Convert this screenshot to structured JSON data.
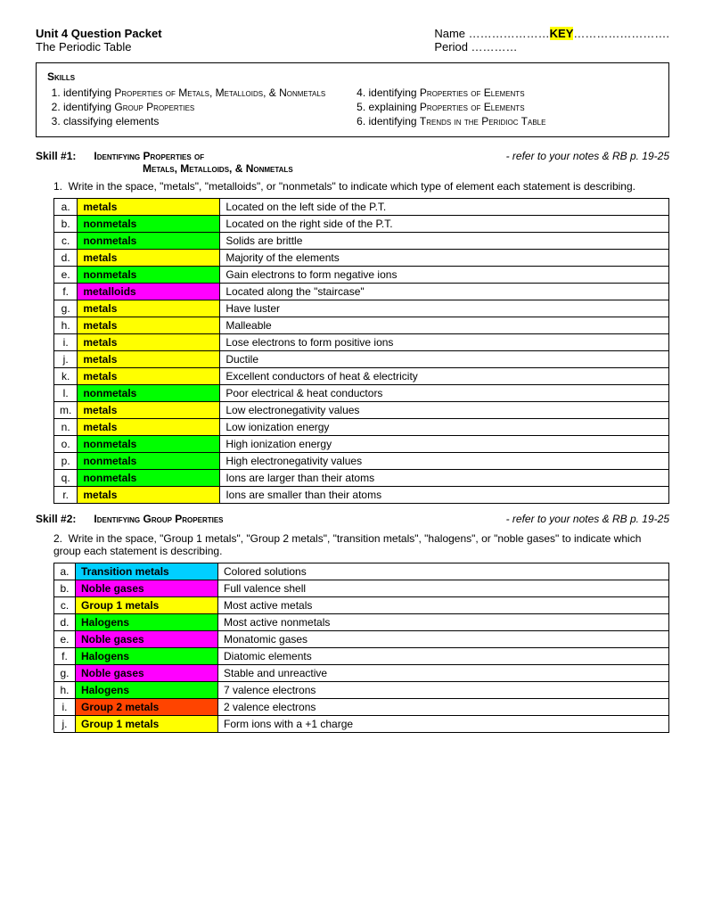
{
  "header": {
    "title": "Unit 4 Question Packet",
    "subtitle": "The Periodic Table",
    "name_label": "Name …………………",
    "key": "KEY",
    "name_dots": "…………………….",
    "period_label": "Period …………"
  },
  "skills_box": {
    "title": "Skills",
    "col1": [
      "identifying Properties of Metals, Metalloids, & Nonmetals",
      "identifying Group Properties",
      "classifying elements"
    ],
    "col2": [
      "identifying Properties of Elements",
      "explaining  Properties of Elements",
      "identifying Trends in the Peridioc Table"
    ]
  },
  "skill1": {
    "label": "Skill #1:",
    "title": "Identifying Properties of Metals, Metalloids, & Nonmetals",
    "ref": "- refer to your notes & RB p. 19-25",
    "instruction": "Write in the space, \"metals\", \"metalloids\", or \"nonmetals\" to indicate which type of element each statement is describing.",
    "rows": [
      {
        "letter": "a.",
        "answer": "metals",
        "highlight": "yellow",
        "description": "Located on the left side of the P.T."
      },
      {
        "letter": "b.",
        "answer": "nonmetals",
        "highlight": "green",
        "description": "Located on the right side of the P.T."
      },
      {
        "letter": "c.",
        "answer": "nonmetals",
        "highlight": "green",
        "description": "Solids are brittle"
      },
      {
        "letter": "d.",
        "answer": "metals",
        "highlight": "yellow",
        "description": "Majority of the elements"
      },
      {
        "letter": "e.",
        "answer": "nonmetals",
        "highlight": "green",
        "description": "Gain electrons to form negative ions"
      },
      {
        "letter": "f.",
        "answer": "metalloids",
        "highlight": "magenta",
        "description": "Located along the \"staircase\""
      },
      {
        "letter": "g.",
        "answer": "metals",
        "highlight": "yellow",
        "description": "Have luster"
      },
      {
        "letter": "h.",
        "answer": "metals",
        "highlight": "yellow",
        "description": "Malleable"
      },
      {
        "letter": "i.",
        "answer": "metals",
        "highlight": "yellow",
        "description": "Lose electrons to form positive ions"
      },
      {
        "letter": "j.",
        "answer": "metals",
        "highlight": "yellow",
        "description": "Ductile"
      },
      {
        "letter": "k.",
        "answer": "metals",
        "highlight": "yellow",
        "description": "Excellent conductors of heat & electricity"
      },
      {
        "letter": "l.",
        "answer": "nonmetals",
        "highlight": "green",
        "description": "Poor electrical & heat conductors"
      },
      {
        "letter": "m.",
        "answer": "metals",
        "highlight": "yellow",
        "description": "Low electronegativity values"
      },
      {
        "letter": "n.",
        "answer": "metals",
        "highlight": "yellow",
        "description": "Low ionization energy"
      },
      {
        "letter": "o.",
        "answer": "nonmetals",
        "highlight": "green",
        "description": "High ionization energy"
      },
      {
        "letter": "p.",
        "answer": "nonmetals",
        "highlight": "green",
        "description": "High electronegativity values"
      },
      {
        "letter": "q.",
        "answer": "nonmetals",
        "highlight": "green",
        "description": "Ions are larger than  their atoms"
      },
      {
        "letter": "r.",
        "answer": "metals",
        "highlight": "yellow",
        "description": "Ions are smaller than their atoms"
      }
    ]
  },
  "skill2": {
    "label": "Skill #2:",
    "title": "Identifying Group Properties",
    "ref": "- refer to your notes & RB p. 19-25",
    "instruction": "Write in the space, \"Group 1 metals\", \"Group 2 metals\", \"transition metals\", \"halogens\", or \"noble gases\" to indicate which group each statement is describing.",
    "rows": [
      {
        "letter": "a.",
        "answer": "Transition metals",
        "highlight": "transition",
        "description": "Colored solutions"
      },
      {
        "letter": "b.",
        "answer": "Noble gases",
        "highlight": "noble",
        "description": "Full valence shell"
      },
      {
        "letter": "c.",
        "answer": "Group 1 metals",
        "highlight": "group1",
        "description": "Most active metals"
      },
      {
        "letter": "d.",
        "answer": "Halogens",
        "highlight": "halogens",
        "description": "Most active nonmetals"
      },
      {
        "letter": "e.",
        "answer": "Noble gases",
        "highlight": "noble",
        "description": "Monatomic gases"
      },
      {
        "letter": "f.",
        "answer": "Halogens",
        "highlight": "halogens",
        "description": "Diatomic elements"
      },
      {
        "letter": "g.",
        "answer": "Noble gases",
        "highlight": "noble",
        "description": "Stable and unreactive"
      },
      {
        "letter": "h.",
        "answer": "Halogens",
        "highlight": "halogens",
        "description": "7 valence electrons"
      },
      {
        "letter": "i.",
        "answer": "Group 2 metals",
        "highlight": "group2",
        "description": "2 valence electrons"
      },
      {
        "letter": "j.",
        "answer": "Group 1 metals",
        "highlight": "group1",
        "description": "Form ions with a +1 charge"
      }
    ]
  }
}
